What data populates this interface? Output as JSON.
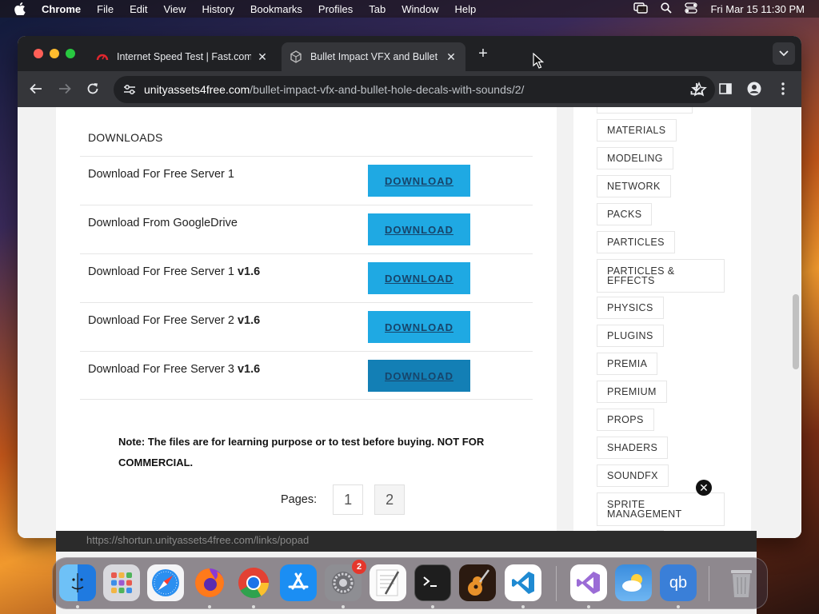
{
  "menubar": {
    "app_name": "Chrome",
    "items": [
      "File",
      "Edit",
      "View",
      "History",
      "Bookmarks",
      "Profiles",
      "Tab",
      "Window",
      "Help"
    ],
    "clock": "Fri Mar 15  11:30 PM"
  },
  "browser": {
    "tabs": [
      {
        "title": "Internet Speed Test | Fast.com",
        "active": false
      },
      {
        "title": "Bullet Impact VFX and Bullet Hole Decals with Sounds",
        "active": true
      }
    ],
    "url_host": "unityassets4free.com",
    "url_path": "/bullet-impact-vfx-and-bullet-hole-decals-with-sounds/2/"
  },
  "page": {
    "downloads_header": "DOWNLOADS",
    "downloads": [
      {
        "label": "Download For Free Server 1",
        "version": "",
        "button": "DOWNLOAD"
      },
      {
        "label": "Download From GoogleDrive",
        "version": "",
        "button": "DOWNLOAD"
      },
      {
        "label": "Download For Free Server 1 ",
        "version": "v1.6",
        "button": "DOWNLOAD"
      },
      {
        "label": "Download For Free Server 2 ",
        "version": "v1.6",
        "button": "DOWNLOAD"
      },
      {
        "label": "Download For Free Server 3 ",
        "version": "v1.6",
        "button": "DOWNLOAD"
      }
    ],
    "note": "Note: The files are for learning purpose or to test before buying. NOT FOR COMMERCIAL.",
    "pages_label": "Pages:",
    "pages": [
      "1",
      "2"
    ],
    "current_page": "2"
  },
  "sidebar": {
    "tags": [
      "MATERIALS",
      "MODELING",
      "NETWORK",
      "PACKS",
      "PARTICLES",
      "PARTICLES & EFFECTS",
      "PHYSICS",
      "PLUGINS",
      "PREMIA",
      "PREMIUM",
      "PROPS",
      "SHADERS",
      "SOUNDFX",
      "SPRITE MANAGEMENT"
    ]
  },
  "status_url": "https://shortun.unityassets4free.com/links/popad",
  "dock": {
    "apps": [
      "Finder",
      "Launchpad",
      "Safari",
      "Firefox",
      "Chrome",
      "App Store",
      "System Settings",
      "TextEdit",
      "Terminal",
      "GarageBand",
      "Visual Studio Code",
      "Visual Studio",
      "Weather",
      "qBittorrent",
      "Trash"
    ],
    "system_settings_badge": "2",
    "qb_label": "qb"
  },
  "colors": {
    "download_button": "#1fa9e3",
    "download_button_hover": "#137fb5",
    "download_text": "#17456b"
  }
}
